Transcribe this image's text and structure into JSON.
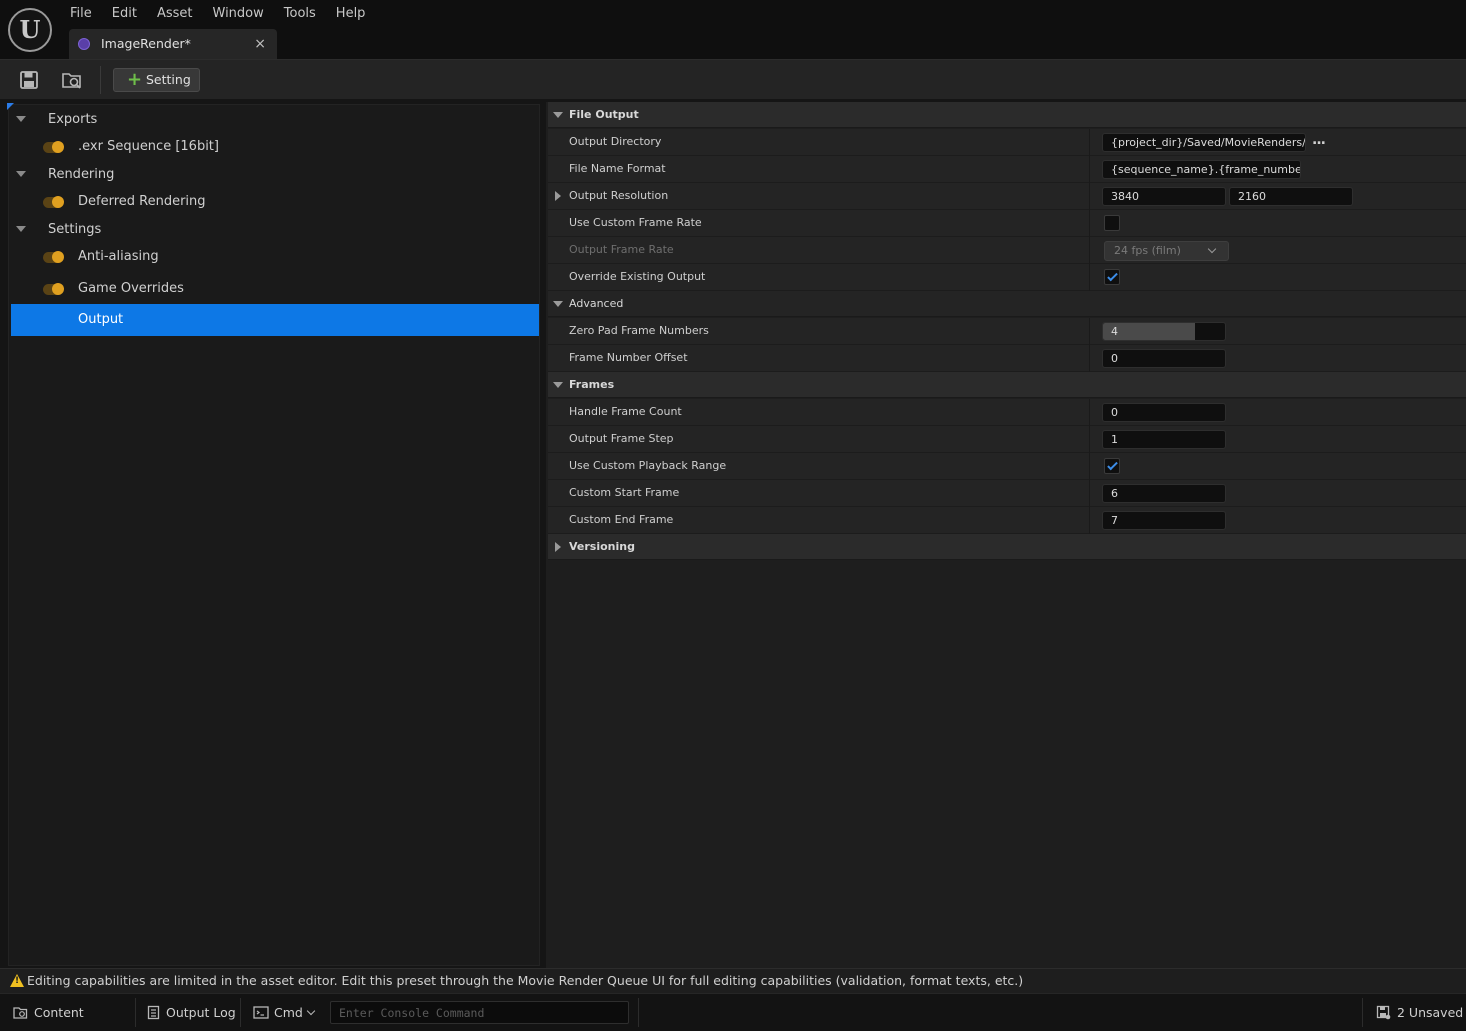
{
  "menu": [
    "File",
    "Edit",
    "Asset",
    "Window",
    "Tools",
    "Help"
  ],
  "document_tab": {
    "label": "ImageRender*",
    "close_glyph": "×"
  },
  "toolbar": {
    "add_setting_label": "Setting"
  },
  "tree": {
    "items": [
      {
        "type": "group",
        "label": "Exports"
      },
      {
        "type": "item",
        "label": ".exr Sequence [16bit]",
        "enabled": true
      },
      {
        "type": "group",
        "label": "Rendering"
      },
      {
        "type": "item",
        "label": "Deferred Rendering",
        "enabled": true
      },
      {
        "type": "group",
        "label": "Settings"
      },
      {
        "type": "item",
        "label": "Anti-aliasing",
        "enabled": true
      },
      {
        "type": "item",
        "label": "Game Overrides",
        "enabled": true
      },
      {
        "type": "item",
        "label": "Output",
        "selected": true
      }
    ]
  },
  "details": {
    "file_output": {
      "header": "File Output",
      "output_directory": {
        "name": "Output Directory",
        "value": "{project_dir}/Saved/MovieRenders/",
        "browse": "..."
      },
      "file_name_format": {
        "name": "File Name Format",
        "value": "{sequence_name}.{frame_number}"
      },
      "output_resolution": {
        "name": "Output Resolution",
        "x": "3840",
        "y": "2160"
      },
      "use_custom_frame_rate": {
        "name": "Use Custom Frame Rate",
        "checked": false
      },
      "output_frame_rate": {
        "name": "Output Frame Rate",
        "value": "24 fps (film)"
      },
      "override_existing_output": {
        "name": "Override Existing Output",
        "checked": true
      }
    },
    "advanced": {
      "header": "Advanced",
      "zero_pad": {
        "name": "Zero Pad Frame Numbers",
        "value": "4",
        "slider_fraction": 0.75
      },
      "frame_number_offset": {
        "name": "Frame Number Offset",
        "value": "0"
      }
    },
    "frames": {
      "header": "Frames",
      "handle_frame_count": {
        "name": "Handle Frame Count",
        "value": "0"
      },
      "output_frame_step": {
        "name": "Output Frame Step",
        "value": "1"
      },
      "use_custom_playback_range": {
        "name": "Use Custom Playback Range",
        "checked": true
      },
      "custom_start_frame": {
        "name": "Custom Start Frame",
        "value": "6"
      },
      "custom_end_frame": {
        "name": "Custom End Frame",
        "value": "7"
      }
    },
    "versioning": {
      "header": "Versioning"
    }
  },
  "info_bar": {
    "message": "Editing capabilities are limited in the asset editor. Edit this preset through the Movie Render Queue UI for full editing capabilities (validation, format texts, etc.)"
  },
  "status_bar": {
    "content_drawer": "Content Drawer",
    "output_log": "Output Log",
    "cmd": "Cmd",
    "console_placeholder": "Enter Console Command",
    "unsaved": "2 Unsaved"
  },
  "colors": {
    "selection": "#0d78e6",
    "toggle_on": "#e0a020",
    "checkbox_tick": "#3c8de8",
    "add_icon": "#6fbf4a",
    "warning": "#f0c020"
  }
}
